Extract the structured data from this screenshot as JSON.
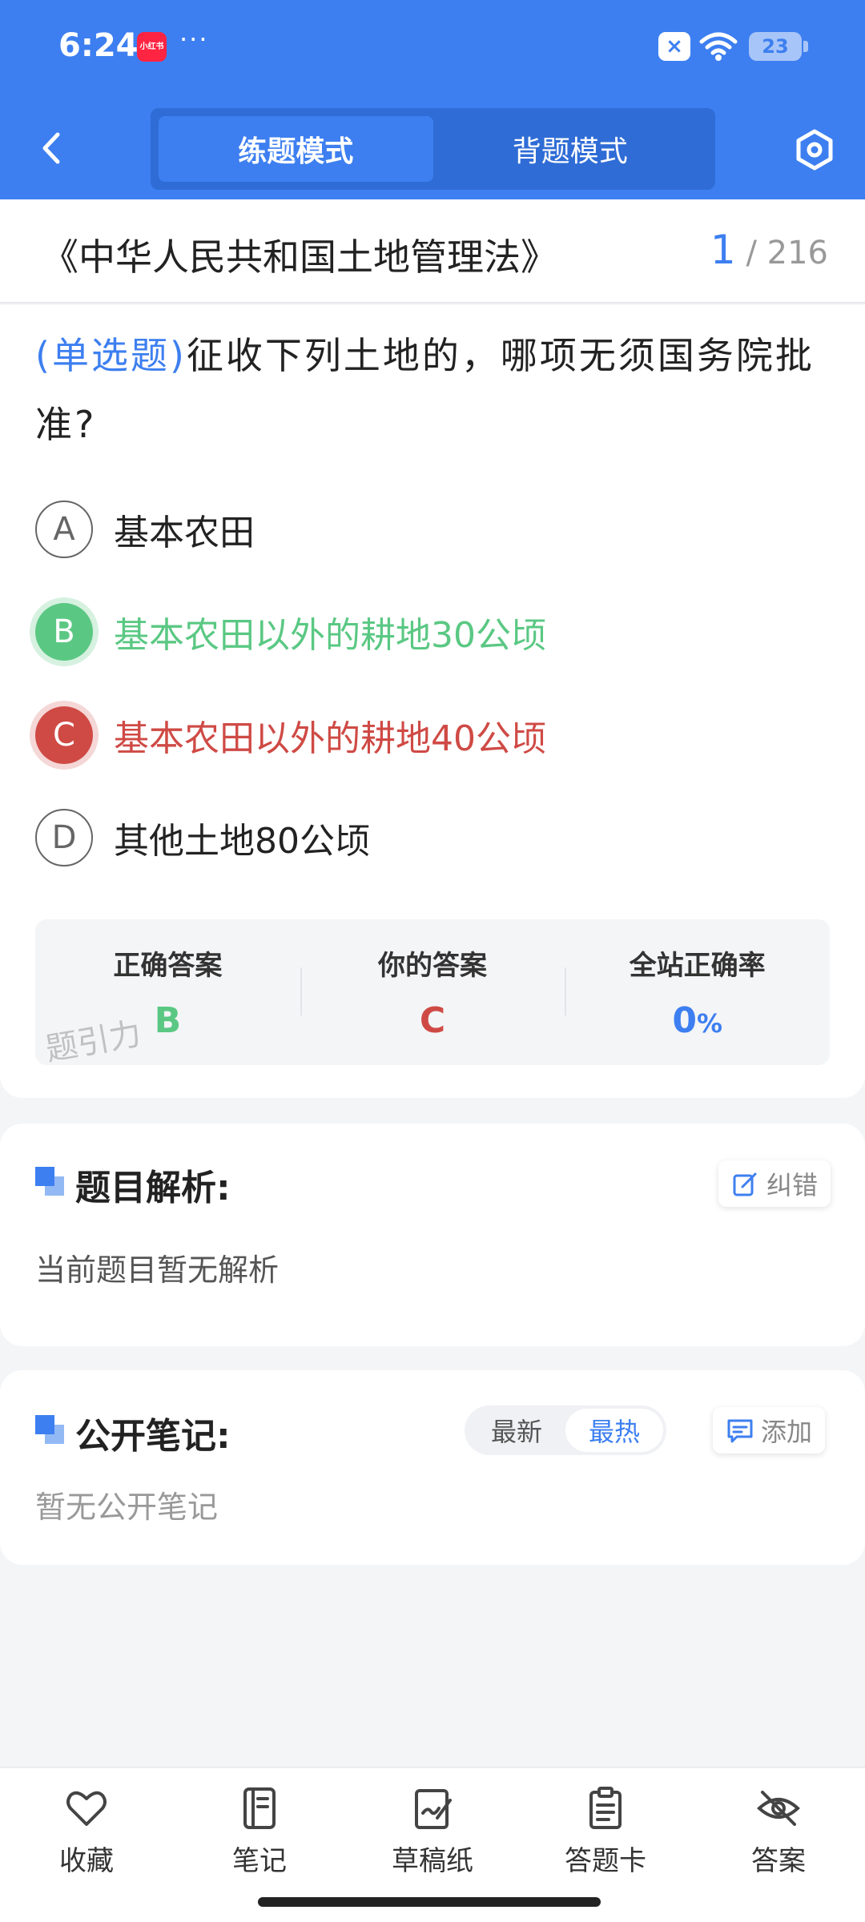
{
  "status_bar": {
    "time": "6:24",
    "app_badge": "小红书",
    "dots": "···",
    "battery": "23"
  },
  "header": {
    "mode_tabs": [
      "练题模式",
      "背题模式"
    ],
    "active_tab": 0
  },
  "title_bar": {
    "law_title": "《中华人民共和国土地管理法》",
    "current": "1",
    "total": "/ 216"
  },
  "question": {
    "type_label": "(单选题)",
    "text": "征收下列土地的，哪项无须国务院批准?",
    "options": [
      {
        "letter": "A",
        "text": "基本农田",
        "state": "normal"
      },
      {
        "letter": "B",
        "text": "基本农田以外的耕地30公顷",
        "state": "correct"
      },
      {
        "letter": "C",
        "text": "基本农田以外的耕地40公顷",
        "state": "wrong"
      },
      {
        "letter": "D",
        "text": "其他土地80公顷",
        "state": "normal"
      }
    ]
  },
  "answer_summary": {
    "correct_label": "正确答案",
    "correct_value": "B",
    "yours_label": "你的答案",
    "yours_value": "C",
    "rate_label": "全站正确率",
    "rate_value": "0",
    "rate_unit": "%",
    "watermark": "题引力"
  },
  "analysis": {
    "title": "题目解析:",
    "report_button": "纠错",
    "body": "当前题目暂无解析"
  },
  "notes": {
    "title": "公开笔记:",
    "sort_options": [
      "最新",
      "最热"
    ],
    "active_sort": 1,
    "add_button": "添加",
    "body": "暂无公开笔记"
  },
  "bottom_nav": {
    "items": [
      "收藏",
      "笔记",
      "草稿纸",
      "答题卡",
      "答案"
    ]
  },
  "colors": {
    "primary": "#3d7ff0",
    "correct": "#5ac883",
    "wrong": "#cf4a45",
    "background": "#f4f5f7"
  }
}
